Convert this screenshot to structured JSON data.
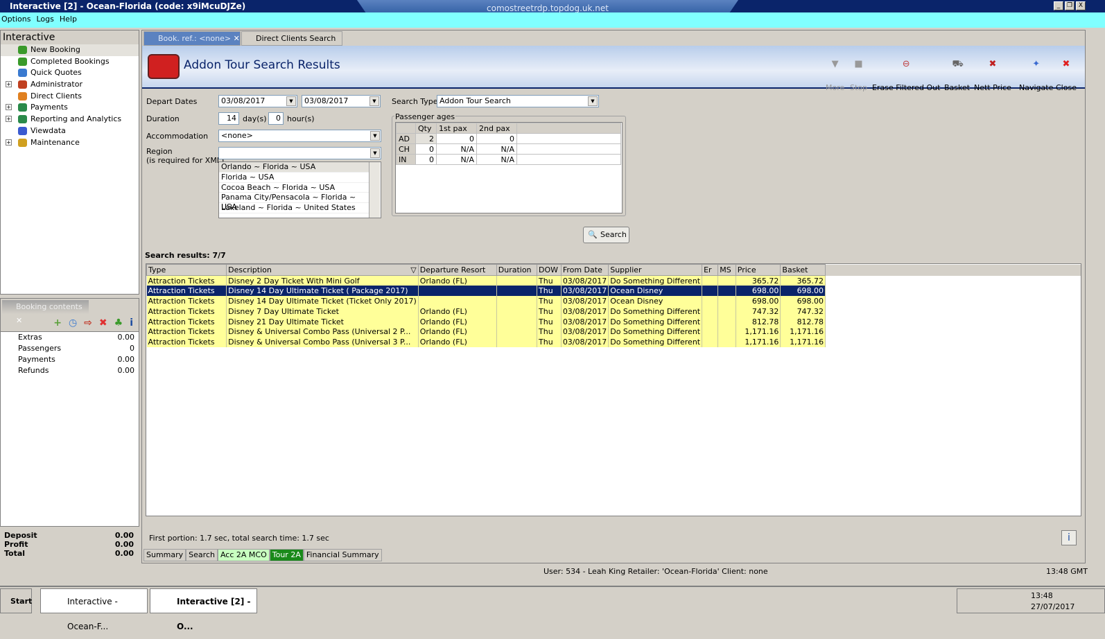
{
  "window": {
    "title": "Interactive [2] - Ocean-Florida (code: x9iMcuDJZe)",
    "rdp_host": "comostreetrdp.topdog.uk.net"
  },
  "menu": [
    "Options",
    "Logs",
    "Help"
  ],
  "sidebar": {
    "title": "Interactive",
    "items": [
      {
        "label": "New Booking",
        "expand": false,
        "color": "#3a9a2a"
      },
      {
        "label": "Completed Bookings",
        "expand": false,
        "color": "#3a9a2a"
      },
      {
        "label": "Quick Quotes",
        "expand": false,
        "color": "#3a7ad0"
      },
      {
        "label": "Administrator",
        "expand": true,
        "color": "#c04020"
      },
      {
        "label": "Direct Clients",
        "expand": false,
        "color": "#e08020"
      },
      {
        "label": "Payments",
        "expand": true,
        "color": "#2a8a4a"
      },
      {
        "label": "Reporting and Analytics",
        "expand": true,
        "color": "#2a8a4a"
      },
      {
        "label": "Viewdata",
        "expand": false,
        "color": "#3a5ad0"
      },
      {
        "label": "Maintenance",
        "expand": true,
        "color": "#d0a020"
      }
    ]
  },
  "booking_contents": {
    "title": "Booking contents",
    "rows": [
      {
        "label": "Extras",
        "value": "0.00"
      },
      {
        "label": "Passengers",
        "value": "0"
      },
      {
        "label": "Payments",
        "value": "0.00"
      },
      {
        "label": "Refunds",
        "value": "0.00"
      }
    ],
    "totals": [
      {
        "label": "Deposit",
        "value": "0.00"
      },
      {
        "label": "Profit",
        "value": "0.00"
      },
      {
        "label": "Total",
        "value": "0.00"
      }
    ]
  },
  "tabs": [
    {
      "label": "Book. ref.: <none>"
    },
    {
      "label": "Direct Clients Search"
    }
  ],
  "page": {
    "title": "Addon Tour Search Results"
  },
  "toolbar": {
    "more": "More",
    "stop": "Stop",
    "erase": "Erase Filtered Out",
    "basket": "Basket",
    "nett": "Nett Price",
    "navigate": "Navigate",
    "close": "Close"
  },
  "form": {
    "depart_label": "Depart Dates",
    "depart_from": "03/08/2017",
    "depart_to": "03/08/2017",
    "duration_label": "Duration",
    "days": "14",
    "days_unit": "day(s)",
    "hours": "0",
    "hours_unit": "hour(s)",
    "accommodation_label": "Accommodation",
    "accommodation": "<none>",
    "region_label": "Region",
    "region_note": "(is required for XML)",
    "region": "",
    "region_options": [
      "Orlando ~ Florida ~ USA",
      "Florida ~ USA",
      "Cocoa Beach ~ Florida ~ USA",
      "Panama City/Pensacola ~  Florida  ~ USA",
      "Lakeland ~ Florida ~ United States"
    ],
    "search_type_label": "Search Type",
    "search_type": "Addon Tour Search",
    "search_button": "Search"
  },
  "passengers": {
    "title": "Passenger ages",
    "headers": [
      "",
      "Qty",
      "1st pax",
      "2nd pax"
    ],
    "rows": [
      [
        "AD",
        "2",
        "0",
        "0"
      ],
      [
        "CH",
        "0",
        "N/A",
        "N/A"
      ],
      [
        "IN",
        "0",
        "N/A",
        "N/A"
      ]
    ]
  },
  "results": {
    "summary": "Search results: 7/7",
    "headers": [
      "Type",
      "Description",
      "Departure Resort",
      "Duration",
      "DOW",
      "From Date",
      "Supplier",
      "Er",
      "MS",
      "Price",
      "Basket"
    ],
    "rows": [
      [
        "Attraction Tickets",
        "Disney 2 Day Ticket With Mini Golf",
        "Orlando (FL)",
        "",
        "Thu",
        "03/08/2017",
        "Do Something Different",
        "",
        "",
        "365.72",
        "365.72"
      ],
      [
        "Attraction Tickets",
        "Disney 14 Day Ultimate Ticket ( Package 2017)",
        "",
        "",
        "Thu",
        "03/08/2017",
        "Ocean Disney",
        "",
        "",
        "698.00",
        "698.00"
      ],
      [
        "Attraction Tickets",
        "Disney 14 Day Ultimate Ticket (Ticket Only 2017)",
        "",
        "",
        "Thu",
        "03/08/2017",
        "Ocean Disney",
        "",
        "",
        "698.00",
        "698.00"
      ],
      [
        "Attraction Tickets",
        "Disney 7 Day Ultimate Ticket",
        "Orlando (FL)",
        "",
        "Thu",
        "03/08/2017",
        "Do Something Different",
        "",
        "",
        "747.32",
        "747.32"
      ],
      [
        "Attraction Tickets",
        "Disney 21 Day Ultimate Ticket",
        "Orlando (FL)",
        "",
        "Thu",
        "03/08/2017",
        "Do Something Different",
        "",
        "",
        "812.78",
        "812.78"
      ],
      [
        "Attraction Tickets",
        "Disney & Universal Combo Pass (Universal 2 P...",
        "Orlando (FL)",
        "",
        "Thu",
        "03/08/2017",
        "Do Something Different",
        "",
        "",
        "1,171.16",
        "1,171.16"
      ],
      [
        "Attraction Tickets",
        "Disney & Universal Combo Pass (Universal 3 P...",
        "Orlando (FL)",
        "",
        "Thu",
        "03/08/2017",
        "Do Something Different",
        "",
        "",
        "1,171.16",
        "1,171.16"
      ]
    ],
    "selected_index": 1,
    "timing": "First portion: 1.7 sec, total search time: 1.7 sec"
  },
  "bottom_tabs": [
    {
      "label": "Summary",
      "bg": "#d4d0c8",
      "fg": "#000"
    },
    {
      "label": "Search",
      "bg": "#d4d0c8",
      "fg": "#000"
    },
    {
      "label": "Acc 2A MCO",
      "bg": "#c8ffc0",
      "fg": "#000"
    },
    {
      "label": "Tour 2A",
      "bg": "#1a8a1a",
      "fg": "#fff"
    },
    {
      "label": "Financial Summary",
      "bg": "#d4d0c8",
      "fg": "#000"
    }
  ],
  "status": {
    "user": "User: 534 - Leah King   Retailer: 'Ocean-Florida'   Client: none",
    "time": "13:48 GMT"
  },
  "taskbar": {
    "start": "Start",
    "tasks": [
      "Interactive - Ocean-F...",
      "Interactive [2] - O..."
    ],
    "clock_time": "13:48",
    "clock_date": "27/07/2017"
  }
}
